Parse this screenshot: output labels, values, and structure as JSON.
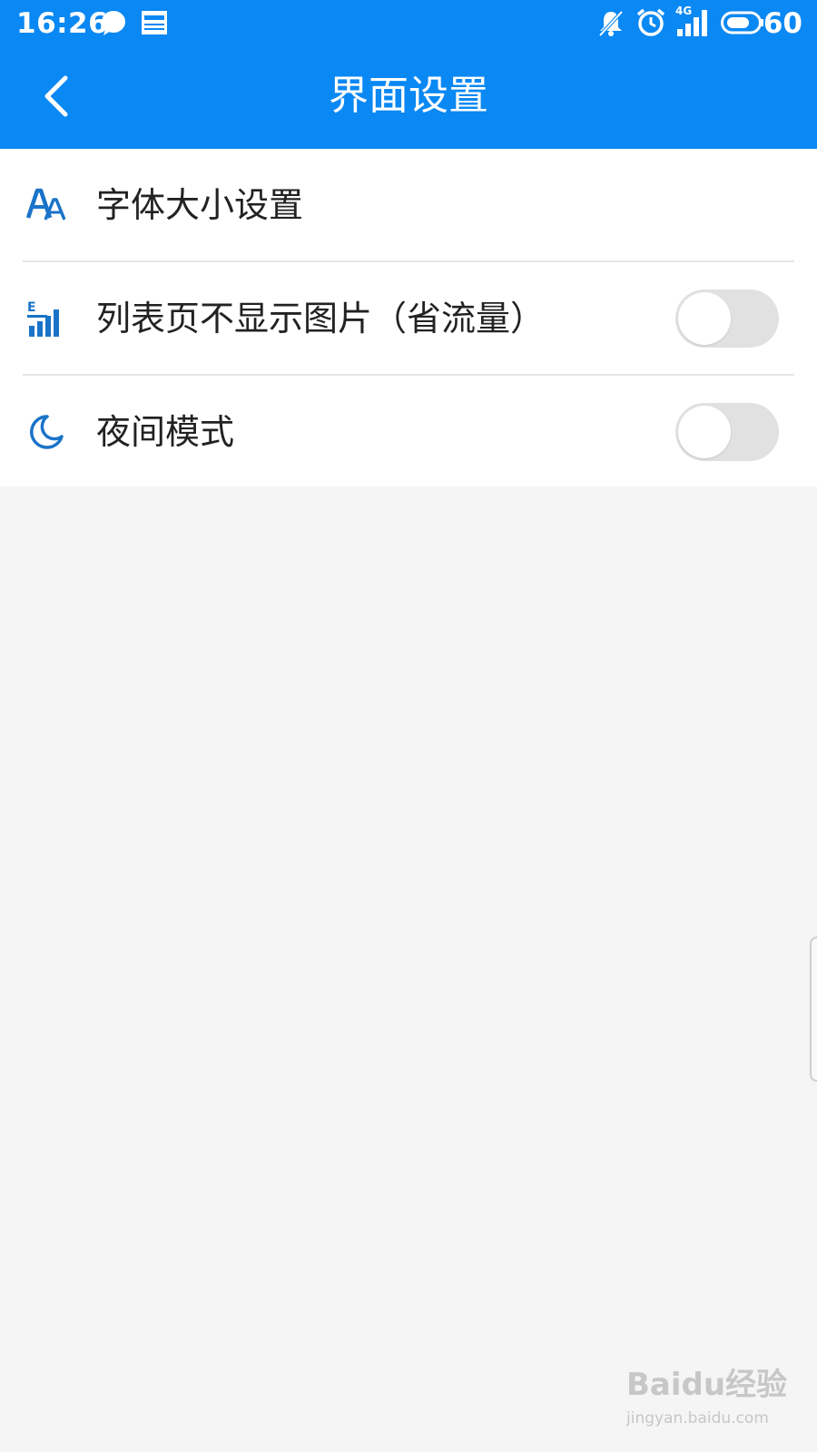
{
  "status_bar": {
    "time": "16:26",
    "network": "4G",
    "battery": "60",
    "icons": [
      "chat-bubble-icon",
      "news-icon",
      "muted-bell-icon",
      "alarm-icon",
      "signal-icon",
      "battery-icon"
    ]
  },
  "header": {
    "title": "界面设置",
    "back_icon": "chevron-left-icon",
    "background": "#0a88f3"
  },
  "settings": {
    "items": [
      {
        "label": "字体大小设置",
        "icon": "font-size-icon",
        "type": "link"
      },
      {
        "label": "列表页不显示图片（省流量）",
        "icon": "data-saver-icon",
        "type": "toggle",
        "on": false
      },
      {
        "label": "夜间模式",
        "icon": "moon-icon",
        "type": "toggle",
        "on": false
      }
    ]
  },
  "watermark": {
    "brand": "Baidu经验",
    "url": "jingyan.baidu.com"
  },
  "colors": {
    "accent": "#0a88f3",
    "icon": "#1a73c8",
    "toggle_off": "#e1e1e1",
    "background": "#f5f5f5"
  }
}
